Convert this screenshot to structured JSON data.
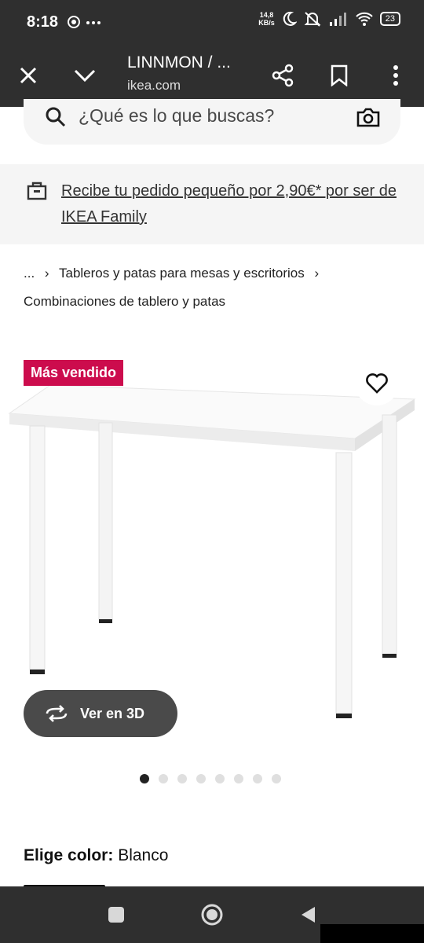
{
  "status": {
    "time": "8:18",
    "net_speed_top": "14,8",
    "net_speed_bottom": "KB/s",
    "battery": "23"
  },
  "toolbar": {
    "title": "LINNMON / ...",
    "url": "ikea.com"
  },
  "search": {
    "placeholder": "¿Qué es lo que buscas?"
  },
  "banner": {
    "text": "Recibe tu pedido pequeño por 2,90€* por ser de IKEA Family"
  },
  "breadcrumb": {
    "ellipsis": "...",
    "item1": "Tableros y patas para mesas y escritorios",
    "item2": "Combinaciones de tablero y patas",
    "sep": "›"
  },
  "product": {
    "badge": "Más vendido",
    "view_3d": "Ver en 3D",
    "carousel": {
      "count": 8,
      "active": 0
    }
  },
  "color": {
    "label": "Elige color:",
    "value": "Blanco"
  },
  "colors": {
    "bars": "#2f2f2f",
    "badge": "#cc0c4d",
    "banner_bg": "#f5f5f5"
  }
}
